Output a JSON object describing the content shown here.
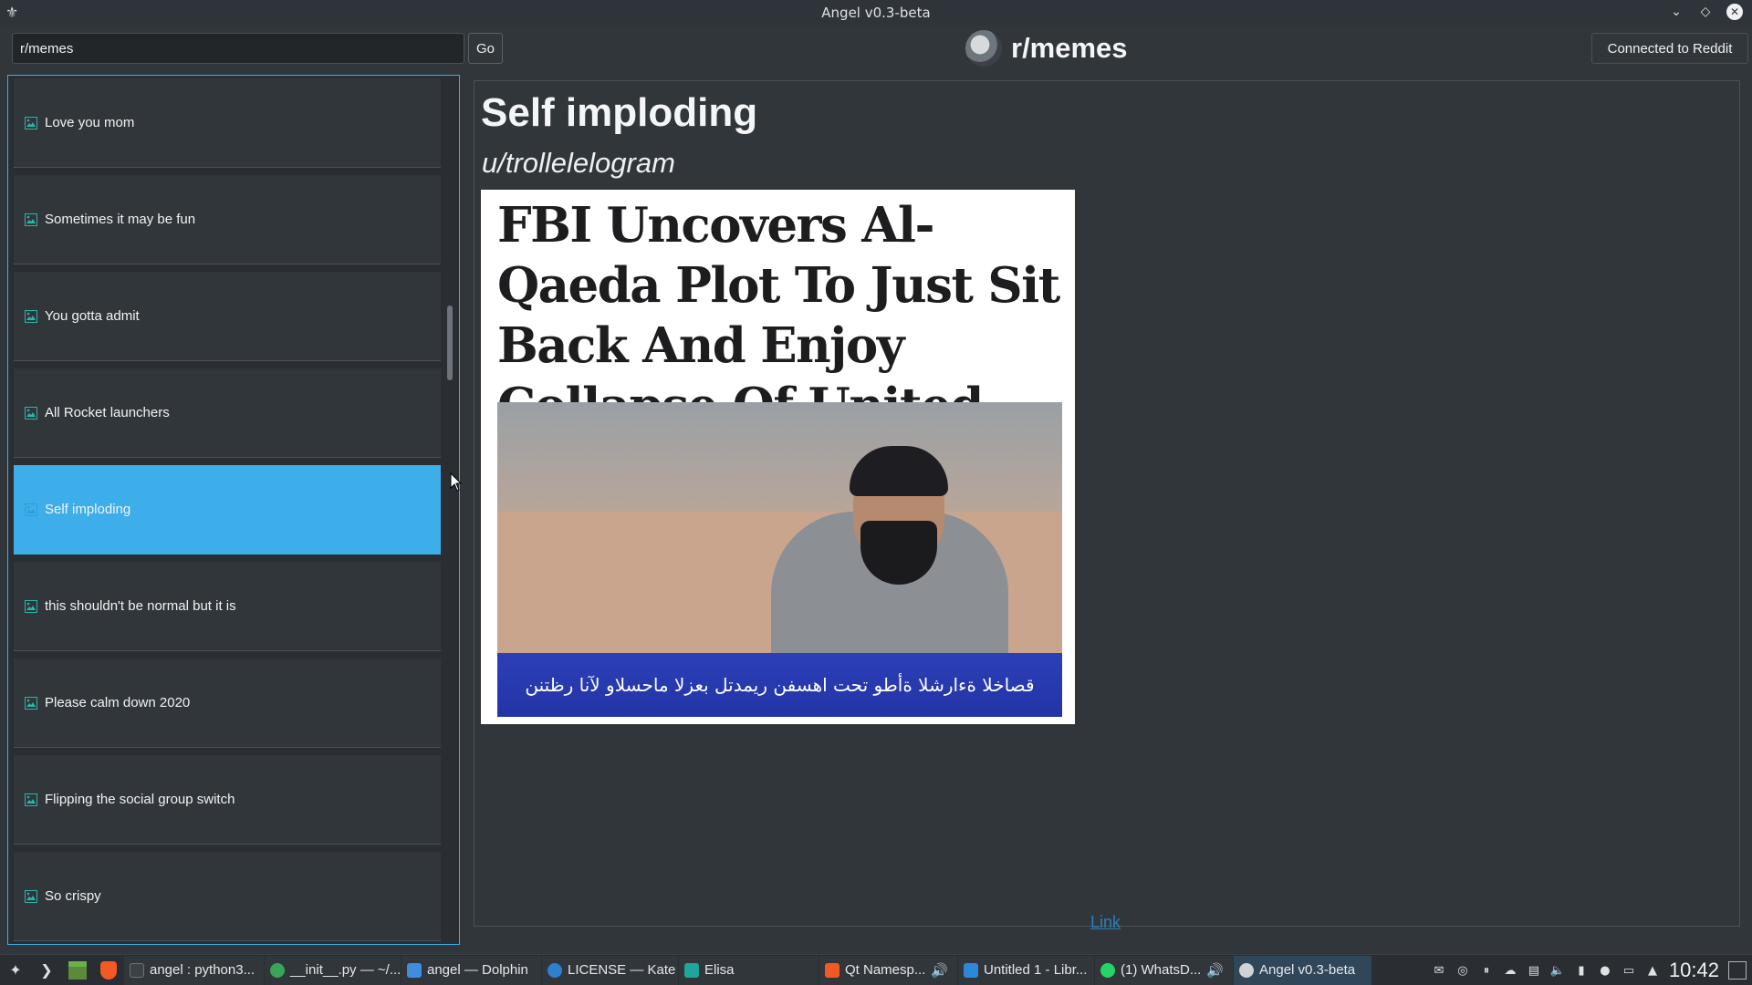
{
  "window": {
    "title": "Angel v0.3-beta"
  },
  "toolbar": {
    "subreddit_input_value": "r/memes",
    "go_label": "Go",
    "connection_label": "Connected to Reddit"
  },
  "header": {
    "subreddit_title": "r/memes"
  },
  "posts": [
    {
      "label": "Love you mom",
      "selected": false
    },
    {
      "label": "Sometimes it may be fun",
      "selected": false
    },
    {
      "label": "You gotta admit",
      "selected": false
    },
    {
      "label": "All Rocket launchers",
      "selected": false
    },
    {
      "label": "Self imploding",
      "selected": true
    },
    {
      "label": "this shouldn't be normal but it is",
      "selected": false
    },
    {
      "label": "Please calm down 2020",
      "selected": false
    },
    {
      "label": "Flipping the social group switch",
      "selected": false
    },
    {
      "label": "So crispy",
      "selected": false
    }
  ],
  "post_view": {
    "title": "Self imploding",
    "author": "u/trollelelogram",
    "image_headline": "FBI Uncovers Al-Qaeda Plot To Just Sit Back And Enjoy Collapse Of United States",
    "image_banner_text": "قصاخلا ةءارشلا ةأطو تحت اهسفن ريمدتل بعزلا ماحسلاو لآنا رظتنن",
    "link_label": "Link"
  },
  "taskbar": {
    "tasks": [
      {
        "label": "angel : python3...",
        "icon": "terminal-icon",
        "color": "#3b4147",
        "active": false
      },
      {
        "label": "__init__.py — ~/...",
        "icon": "kate-icon",
        "color": "#3aa55a",
        "active": false
      },
      {
        "label": "angel — Dolphin",
        "icon": "folder-icon",
        "color": "#3d8ee0",
        "active": false
      },
      {
        "label": "LICENSE — Kate",
        "icon": "kate-icon",
        "color": "#2f7fd1",
        "active": false
      },
      {
        "label": "Elisa",
        "icon": "music-icon",
        "color": "#1fa59a",
        "active": false
      },
      {
        "label": "Qt Namesp...",
        "icon": "brave-icon",
        "color": "#f15a24",
        "active": false
      },
      {
        "label": "Untitled 1 - Libr...",
        "icon": "writer-icon",
        "color": "#2d88d8",
        "active": false
      },
      {
        "label": "(1) WhatsD...",
        "icon": "whatsapp-icon",
        "color": "#25d366",
        "active": false
      },
      {
        "label": "Angel v0.3-beta",
        "icon": "angel-icon",
        "color": "#cfd3d6",
        "active": true
      }
    ],
    "clock": "10:42"
  },
  "colors": {
    "accent": "#3daee9",
    "window_bg": "#31363b",
    "link": "#2980b9"
  }
}
